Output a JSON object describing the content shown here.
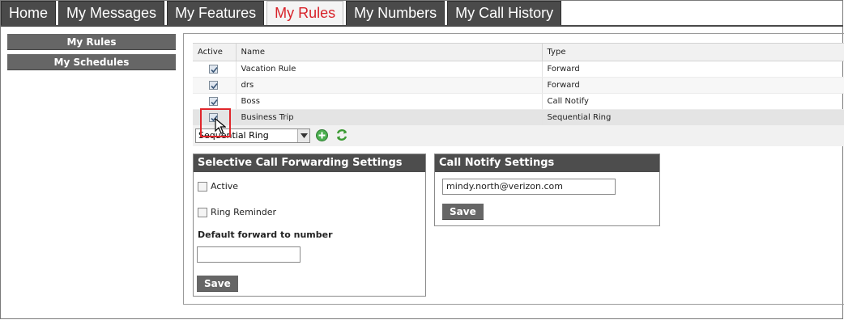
{
  "nav": {
    "tabs": [
      {
        "label": "Home"
      },
      {
        "label": "My Messages"
      },
      {
        "label": "My Features"
      },
      {
        "label": "My Rules",
        "active": true
      },
      {
        "label": "My Numbers"
      },
      {
        "label": "My Call History"
      }
    ]
  },
  "sidebar": {
    "items": [
      {
        "label": "My Rules"
      },
      {
        "label": "My Schedules"
      }
    ]
  },
  "rules": {
    "headers": {
      "active": "Active",
      "name": "Name",
      "type": "Type"
    },
    "rows": [
      {
        "active": true,
        "name": "Vacation Rule",
        "type": "Forward"
      },
      {
        "active": true,
        "name": "drs",
        "type": "Forward"
      },
      {
        "active": true,
        "name": "Boss",
        "type": "Call Notify"
      },
      {
        "active": true,
        "name": "Business Trip",
        "type": "Sequential Ring"
      }
    ],
    "rule_type_select": "Sequential Ring"
  },
  "selective_forwarding": {
    "title": "Selective Call Forwarding Settings",
    "active_label": "Active",
    "ring_reminder_label": "Ring Reminder",
    "forward_label": "Default forward to number",
    "forward_value": "",
    "save_label": "Save"
  },
  "call_notify": {
    "title": "Call Notify Settings",
    "email_value": "mindy.north@verizon.com",
    "save_label": "Save"
  },
  "icons": {
    "add": "add-circle-icon",
    "refresh": "refresh-icon",
    "dropdown": "chevron-down-icon",
    "cursor": "mouse-pointer-icon"
  },
  "colors": {
    "nav_bg": "#4a4a4a",
    "active_tab_text": "#d8232a",
    "highlight": "#e0262b",
    "panel_title_bg": "#4d4d4d"
  }
}
